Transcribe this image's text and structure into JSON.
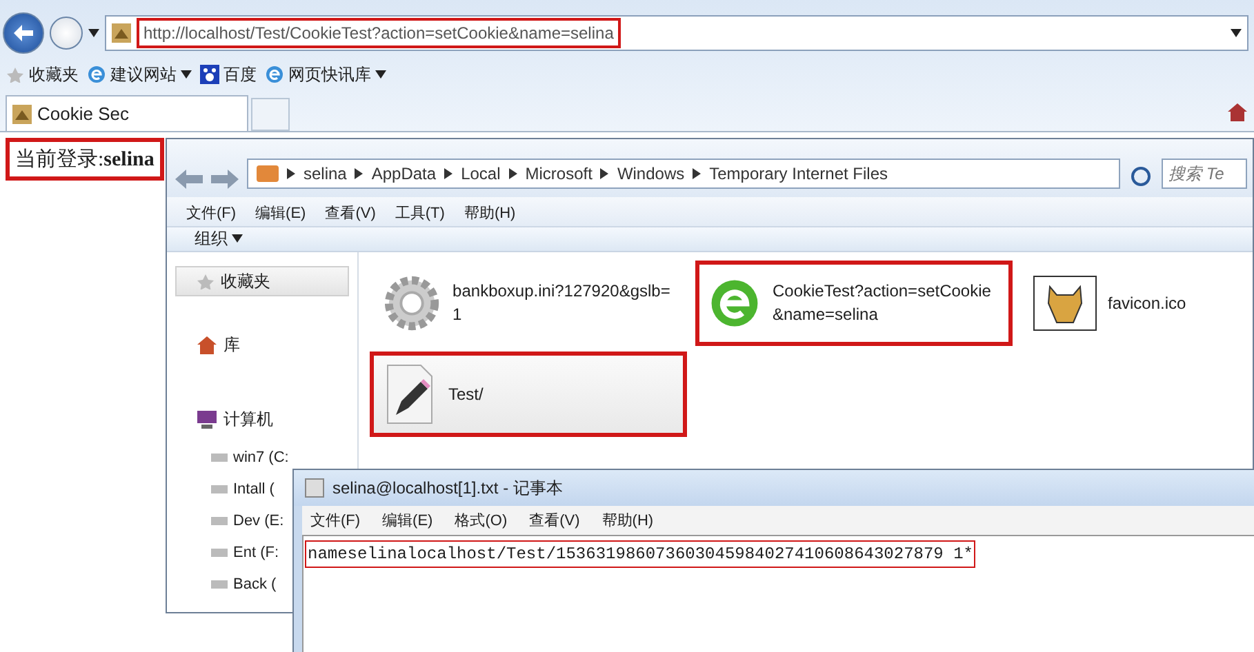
{
  "browser": {
    "address": {
      "value": "http://localhost/Test/CookieTest?action=setCookie&name=selina",
      "highlighted": true
    },
    "favorites": [
      {
        "label": "收藏夹",
        "has_menu": false,
        "kind": "star"
      },
      {
        "label": "建议网站",
        "has_menu": true,
        "kind": "ie"
      },
      {
        "label": "百度",
        "has_menu": false,
        "kind": "paw"
      },
      {
        "label": "网页快讯库",
        "has_menu": true,
        "kind": "ie"
      }
    ],
    "tabs": [
      {
        "label": "Cookie Sec",
        "selected": true
      }
    ],
    "page_text": {
      "text": "当前登录:**selina**",
      "highlighted": true
    }
  },
  "explorer": {
    "breadcrumb": [
      "selina",
      "AppData",
      "Local",
      "Microsoft",
      "Windows",
      "Temporary Internet Files"
    ],
    "search": {
      "placeholder": "搜索 Te"
    },
    "menu": [
      "文件(F)",
      "编辑(E)",
      "查看(V)",
      "工具(T)",
      "帮助(H)"
    ],
    "organize": "组织",
    "sidebar": [
      {
        "label": "收藏夹",
        "kind": "star",
        "selected": true
      },
      {
        "label": "库",
        "kind": "house",
        "selected": false
      },
      {
        "label": "计算机",
        "kind": "computer",
        "selected": false,
        "children": [
          {
            "label": "win7 (C:"
          },
          {
            "label": "Intall ("
          },
          {
            "label": "Dev (E:"
          },
          {
            "label": "Ent (F:"
          },
          {
            "label": "Back ("
          }
        ]
      }
    ],
    "files": [
      {
        "name": "bankboxup.ini?127920&gslb=1",
        "kind": "gear",
        "selected": false,
        "highlighted": false
      },
      {
        "name": "CookieTest?action=setCookie&name=selina",
        "kind": "ie",
        "selected": false,
        "highlighted": true
      },
      {
        "name": "favicon.ico",
        "kind": "cat",
        "selected": false,
        "highlighted": false
      },
      {
        "name": "Test/",
        "kind": "text",
        "selected": true,
        "highlighted": true
      }
    ]
  },
  "notepad": {
    "title": "selina@localhost[1].txt - 记事本",
    "menu": [
      "文件(F)",
      "编辑(E)",
      "格式(O)",
      "查看(V)",
      "帮助(H)"
    ],
    "content": {
      "text": "nameselinalocalhost/Test/153631986073603045984027410608643027879 1*",
      "highlighted": true
    }
  }
}
